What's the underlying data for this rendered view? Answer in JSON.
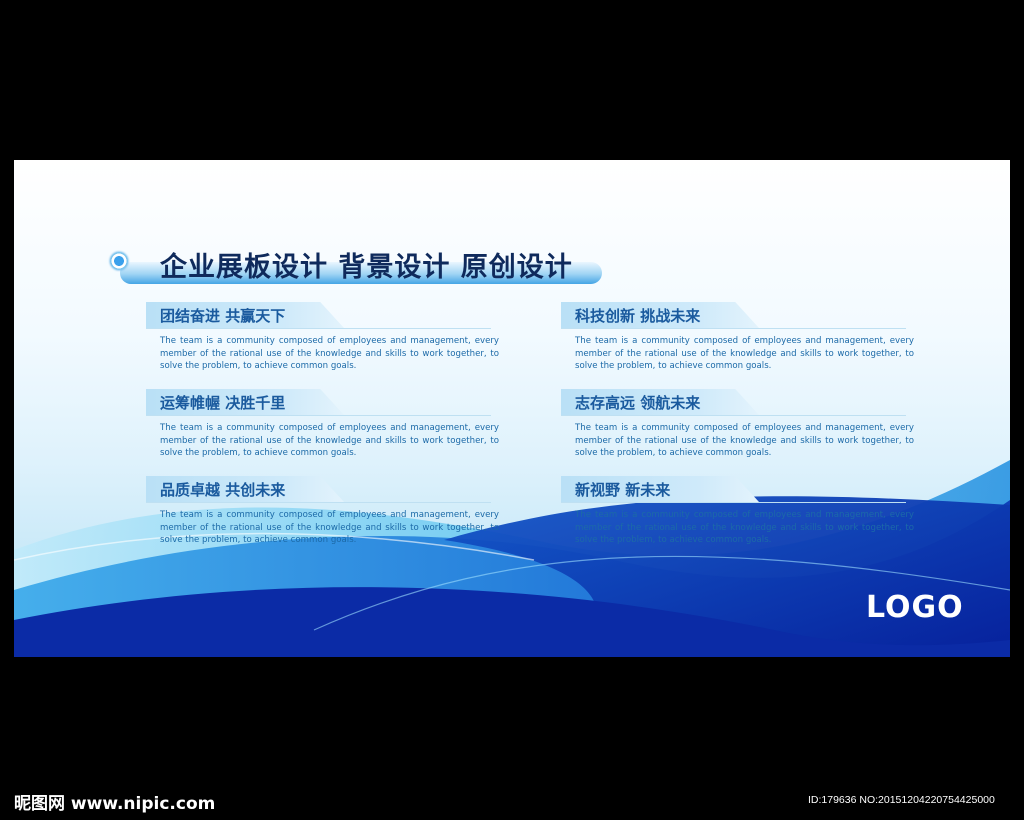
{
  "board": {
    "title": "企业展板设计 背景设计 原创设计",
    "logo": "LOGO",
    "sections": [
      {
        "title": "团结奋进 共赢天下",
        "body": "The team is a community composed of employees and management, every member of the rational use of the knowledge and skills to work together, to solve the problem, to achieve common goals."
      },
      {
        "title": "运筹帷幄 决胜千里",
        "body": "The team is a community composed of employees and management, every member of the rational use of the knowledge and skills to work together, to solve the problem, to achieve common goals."
      },
      {
        "title": "品质卓越 共创未来",
        "body": "The team is a community composed of employees and management, every member of the rational use of the knowledge and skills to work together, to solve the problem, to achieve common goals."
      },
      {
        "title": "科技创新 挑战未来",
        "body": "The team is a community composed of employees and management, every member of the rational use of the knowledge and skills to work together, to solve the problem, to achieve common goals."
      },
      {
        "title": "志存高远 领航未来",
        "body": "The team is a community composed of employees and management, every member of the rational use of the knowledge and skills to work together, to solve the problem, to achieve common goals."
      },
      {
        "title": "新视野 新未来",
        "body": "The team is a community composed of employees and management, every member of the rational use of the knowledge and skills to work together, to solve the problem, to achieve common goals."
      }
    ]
  },
  "watermark": {
    "site": "昵图网 www.nipic.com",
    "id": "ID:179636 NO:20151204220754425000"
  },
  "colors": {
    "title": "#0f2a5c",
    "section_title": "#1a5a9e",
    "body_text": "#1c6aa8",
    "deep_blue": "#0a2aa8",
    "light_blue": "#4fc3f0"
  }
}
